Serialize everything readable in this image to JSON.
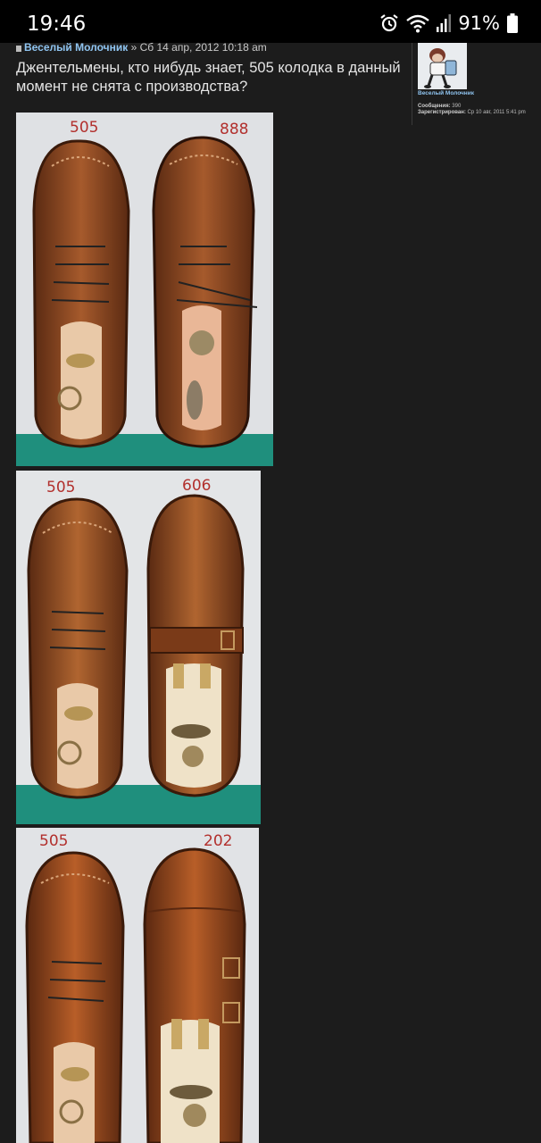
{
  "status_bar": {
    "time": "19:46",
    "battery": "91%",
    "icons": [
      "alarm-icon",
      "wifi-icon",
      "signal-icon",
      "battery-icon"
    ]
  },
  "post": {
    "author": "Веселый Молочник",
    "separator": "»",
    "date": "Сб 14 апр, 2012 10:18 am",
    "text": "Джентельмены, кто нибудь знает, 505 колодка в данный момент не снята с производства?"
  },
  "profile": {
    "username": "Веселый Молочник",
    "posts_label": "Сообщения:",
    "posts_value": "390",
    "registered_label": "Зарегистрирован:",
    "registered_value": "Ср 10 авг, 2011 5:41 pm"
  },
  "photos": [
    {
      "left_label": "505",
      "right_label": "888"
    },
    {
      "left_label": "505",
      "right_label": "606"
    },
    {
      "left_label": "505",
      "right_label": "202"
    }
  ],
  "colors": {
    "background": "#1c1c1c",
    "link": "#8fc4f0",
    "label_red": "#b2302d",
    "shoe_brown": "#8e4a22",
    "mat_teal": "#1f8f7d"
  }
}
